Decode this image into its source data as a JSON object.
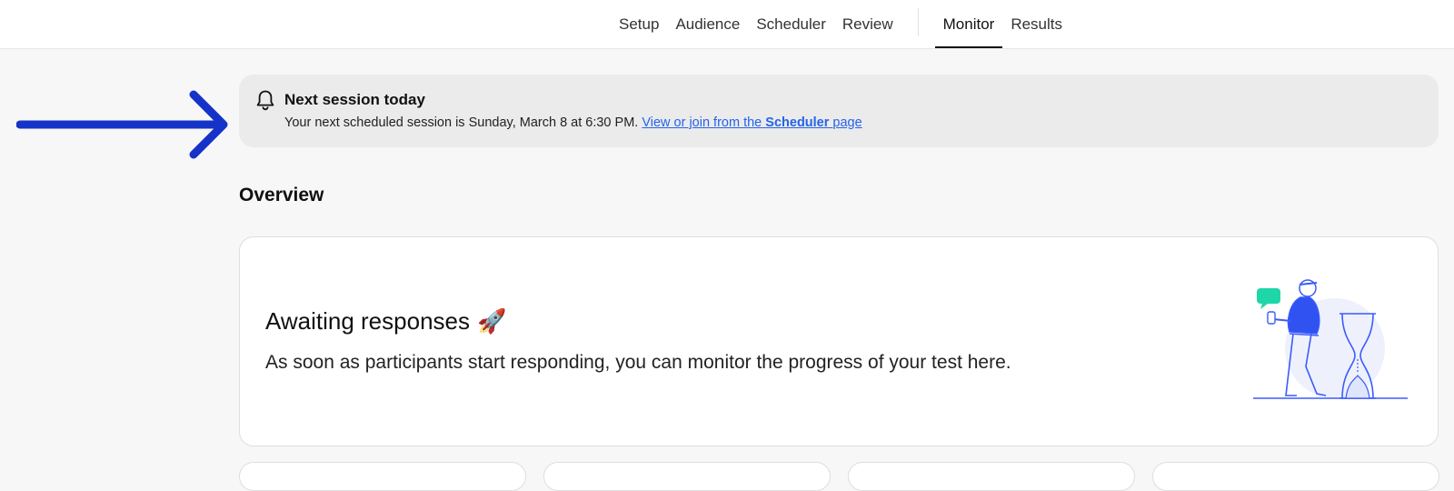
{
  "nav": {
    "tabs": [
      {
        "label": "Setup"
      },
      {
        "label": "Audience"
      },
      {
        "label": "Scheduler"
      },
      {
        "label": "Review"
      },
      {
        "label": "Monitor"
      },
      {
        "label": "Results"
      }
    ],
    "active_tab": "Monitor"
  },
  "notice": {
    "icon": "bell-icon",
    "title": "Next session today",
    "body_prefix": "Your next scheduled session is Sunday, March 8 at 6:30 PM.",
    "link_pre": "View or join from the",
    "link_bold": "Scheduler",
    "link_post": "page"
  },
  "overview": {
    "section_title": "Overview",
    "card_title": "Awaiting responses",
    "card_emoji": "🚀",
    "card_text": "As soon as participants start responding, you can monitor the progress of your test here."
  },
  "colors": {
    "accent": "#2563eb",
    "arrow": "#1533c8",
    "illustration": "#3b5bfd",
    "chat_bubble": "#1fd6a8"
  }
}
